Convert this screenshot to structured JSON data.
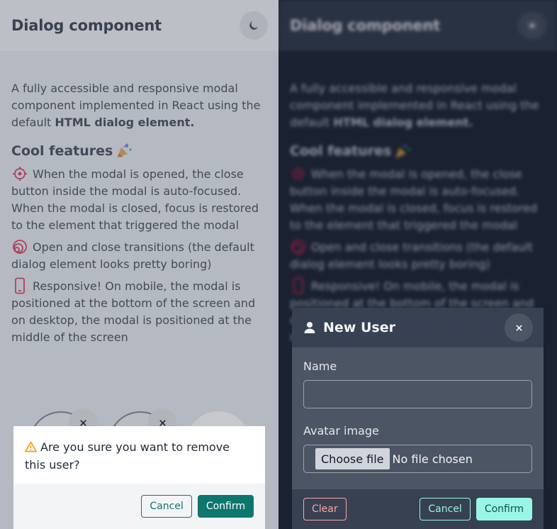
{
  "page": {
    "title": "Dialog component",
    "intro_text": "A fully accessible and responsive modal component implemented in React using the default ",
    "intro_bold": "HTML dialog element.",
    "features_title": "Cool features",
    "features": [
      {
        "icon": "target-icon",
        "text": "When the modal is opened, the close button inside the modal is auto-focused. When the modal is closed, focus is restored to the element that triggered the modal"
      },
      {
        "icon": "transitions-icon",
        "text": "Open and close transitions (the default dialog element looks pretty boring)"
      },
      {
        "icon": "mobile-icon",
        "text": "Responsive! On mobile, the modal is positioned at the bottom of the screen and on desktop, the modal is positioned at the middle of the screen"
      }
    ],
    "light_theme_icon": "moon-icon",
    "dark_theme_icon": "sun-icon"
  },
  "confirm_dialog": {
    "icon": "warning-icon",
    "message": "Are you sure you want to remove this user?",
    "cancel_label": "Cancel",
    "confirm_label": "Confirm"
  },
  "new_user_dialog": {
    "title": "New User",
    "icon": "user-icon",
    "name_label": "Name",
    "name_value": "",
    "avatar_label": "Avatar image",
    "file_button_label": "Choose file",
    "file_status": "No file chosen",
    "clear_label": "Clear",
    "cancel_label": "Cancel",
    "confirm_label": "Confirm"
  },
  "colors": {
    "accent_teal": "#0f766e",
    "accent_mint": "#99f6e4",
    "feature_icon": "#e11d48",
    "clear_red": "#fca5a5"
  }
}
